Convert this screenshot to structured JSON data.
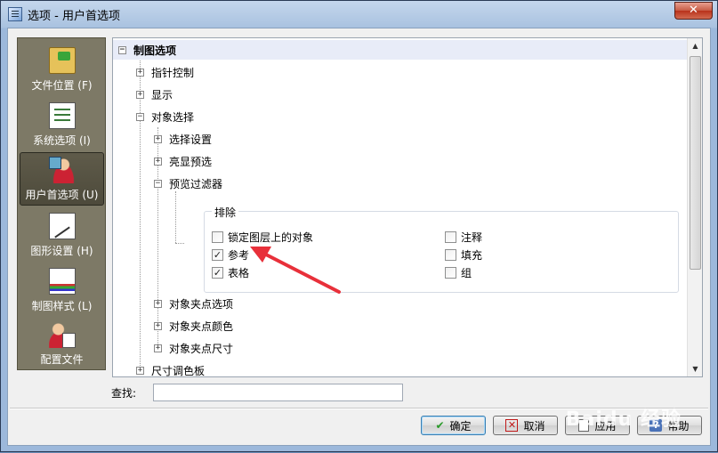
{
  "window": {
    "title": "选项 - 用户首选项",
    "close_glyph": "✕"
  },
  "nav": {
    "items": [
      {
        "label": "文件位置 (F)",
        "icon": "folder-icon"
      },
      {
        "label": "系统选项 (I)",
        "icon": "checklist-icon"
      },
      {
        "label": "用户首选项 (U)",
        "icon": "user-preferences-icon",
        "selected": true
      },
      {
        "label": "图形设置 (H)",
        "icon": "graphics-settings-icon"
      },
      {
        "label": "制图样式 (L)",
        "icon": "drafting-style-icon"
      },
      {
        "label": "配置文件",
        "icon": "profile-icon"
      }
    ]
  },
  "tree": {
    "root": "制图选项",
    "items": [
      {
        "label": "指针控制",
        "state": "collapsed"
      },
      {
        "label": "显示",
        "state": "collapsed"
      },
      {
        "label": "对象选择",
        "state": "expanded"
      },
      {
        "label": "选择设置",
        "state": "collapsed"
      },
      {
        "label": "亮显预选",
        "state": "collapsed"
      },
      {
        "label": "预览过滤器",
        "state": "expanded"
      },
      {
        "label": "对象夹点选项",
        "state": "collapsed"
      },
      {
        "label": "对象夹点颜色",
        "state": "collapsed"
      },
      {
        "label": "对象夹点尺寸",
        "state": "collapsed"
      },
      {
        "label": "尺寸调色板",
        "state": "collapsed"
      }
    ],
    "exclude_group": {
      "title": "排除",
      "options": [
        {
          "label": "锁定图层上的对象",
          "checked": false
        },
        {
          "label": "参考",
          "checked": true
        },
        {
          "label": "表格",
          "checked": true
        },
        {
          "label": "注释",
          "checked": false
        },
        {
          "label": "填充",
          "checked": false
        },
        {
          "label": "组",
          "checked": false
        }
      ]
    }
  },
  "search": {
    "label": "查找:",
    "value": ""
  },
  "buttons": {
    "ok": "确定",
    "cancel": "取消",
    "apply": "应用",
    "help": "帮助"
  },
  "glyphs": {
    "check": "✔",
    "checkmark": "✓",
    "cancel_x": "✕",
    "help_q": "?",
    "expanded": "−",
    "collapsed": "+"
  },
  "watermark": "Baidu 经验",
  "colors": {
    "nav_bg": "#7d7966",
    "annotation_arrow": "#e8303a",
    "header_row": "#e8ecf8"
  }
}
